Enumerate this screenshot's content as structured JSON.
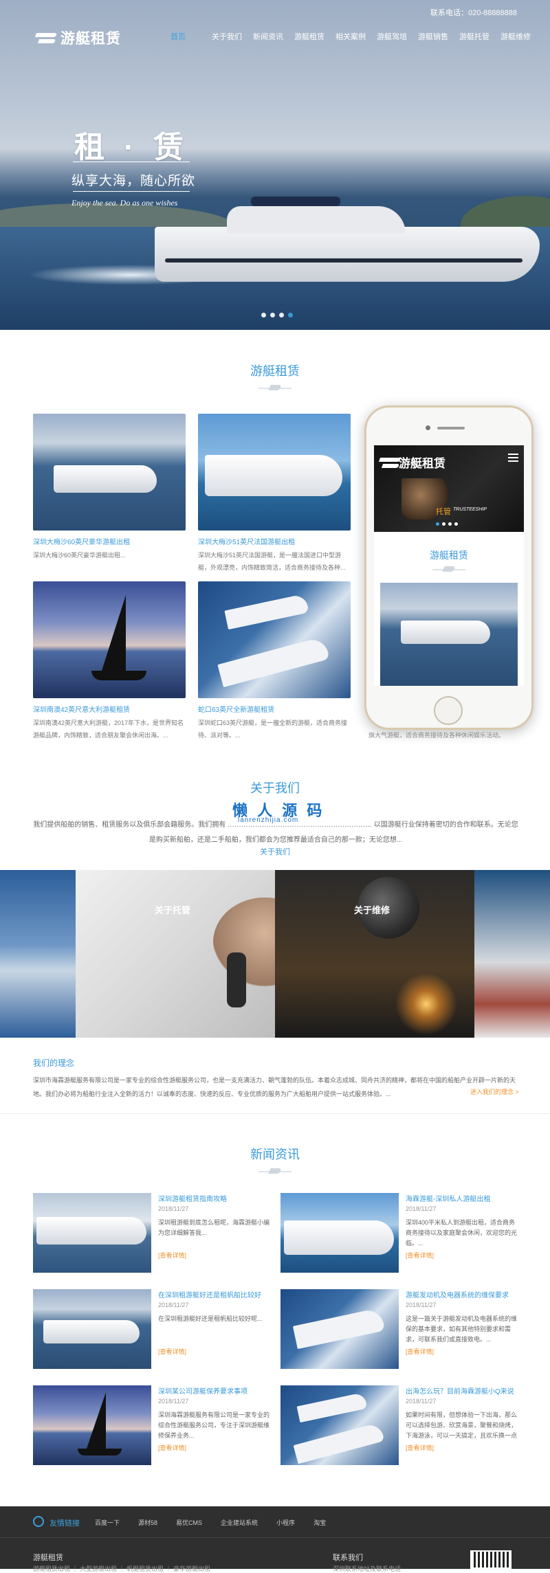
{
  "header": {
    "phone": "联系电话：020-88888888",
    "logo": "游艇租赁",
    "nav": [
      "首页",
      "关于我们",
      "新闻资讯",
      "游艇租赁",
      "相关案例",
      "游艇驾培",
      "游艇销售",
      "游艇托管",
      "游艇维修"
    ]
  },
  "hero": {
    "title": "租 · 赁",
    "subtitle": "纵享大海，随心所欲",
    "english": "Enjoy the sea.  Do as one wishes"
  },
  "rental": {
    "title": "游艇租赁",
    "cards": [
      {
        "title": "深圳大梅沙60英尺豪华游艇出租",
        "desc": "深圳大梅沙60英尺豪华游艇出租..."
      },
      {
        "title": "深圳大梅沙51英尺法国游艇出租",
        "desc": "深圳大梅沙51英尺法国游艇，是一艘法国进口中型游艇，外观漂亮，内饰精致简洁，适合商务接待及各种..."
      },
      {
        "title": "深圳南澳42英尺意大利游艇租赁",
        "desc": "深圳南澳42英尺意大利游艇，2017年下水，是世界知名游艇品牌，内饰精致，适合朋友聚会休闲出海。..."
      },
      {
        "title": "蛇口63英尺全新游艇租赁",
        "desc": "深圳蛇口63英尺游艇，是一艘全新的游艇，适合商务接待、派对等。..."
      }
    ],
    "phone": {
      "logo": "游艇租赁",
      "tag": "托管",
      "tag_en": "TRUSTEESHIP",
      "title": "游艇租赁",
      "overflow": "旗大气游艇，适合商务接待及各种休闲娱乐活动。"
    }
  },
  "about": {
    "title": "关于我们",
    "watermark": "懒 人 源 码",
    "watermark_en": "lanrenzhijia.com",
    "text": "我们提供船舶的销售、租赁服务以及俱乐部会籍服务。我们拥有 ……………………………………………………… 以国游艇行业保持着密切的合作和联系。无论您是购买新船舶，还是二手船舶，我们都会为您推荐最适合自己的那一款；无论您想...",
    "link": "关于我们",
    "band_labels": [
      "关于托管",
      "关于维修"
    ],
    "idea_title": "我们的理念",
    "idea_text": "深圳市海霖游艇服务有限公司是一家专业的综合性游艇服务公司，也是一支充满活力、朝气蓬勃的队伍。本着众志成城、同舟共济的精神，都将在中国的船舶产业开辟一片新的天地。我们办必将为船舶行业注入全新的活力！以诚奉的态度、快速的反应、专业优质的服务为广大船舶用户提供一站式服务体验。...",
    "idea_link": "进入我们的理念 >"
  },
  "news": {
    "title": "新闻资讯",
    "more": "[查看详情]",
    "items": [
      {
        "title": "深圳游艇租赁指南攻略",
        "date": "2018/11/27",
        "excerpt": "深圳租游艇到底怎么租呢，海霖游艇小编为您详细解答我..."
      },
      {
        "title": "海霖游艇-深圳私人游艇出租",
        "date": "2018/11/27",
        "excerpt": "深圳400平米私人到游艇出租，适合商务商务接待以及家庭聚会休闲，欢迎您的光临。..."
      },
      {
        "title": "在深圳租游艇好还是租帆船比较好",
        "date": "2018/11/27",
        "excerpt": "在深圳租游艇好还是租帆船比较好呢..."
      },
      {
        "title": "游艇发动机及电器系统的维保要求",
        "date": "2018/11/27",
        "excerpt": "这是一篇关于游艇发动机及电器系统的维保的基本要求，如有其他特别要求和需求，可联系我们或直接致电。..."
      },
      {
        "title": "深圳某公司游艇保养要求事项",
        "date": "2018/11/27",
        "excerpt": "深圳海霖游艇服务有限公司是一家专业的综合性游艇服务公司，专注于深圳游艇维修保养业务..."
      },
      {
        "title": "出海怎么玩？目前海霖游艇小Q来说",
        "date": "2018/11/27",
        "excerpt": "如果时间有限，但想体验一下出海，那么可以选择包游、欣赏海景，聚餐和烧烤，下海游泳，可以一天搞定，且欢乐换一点"
      }
    ]
  },
  "footer": {
    "links_label": "友情链接",
    "links": [
      "百度一下",
      "源材58",
      "易优CMS",
      "企业建站系统",
      "小程序",
      "淘宝"
    ],
    "about": "游艇租赁",
    "contact": "联系我们",
    "sub1": "游艇租赁出租 ｜ 大型游艇出租 ｜ 帆艇租赁出租 ｜ 豪华游艇出租",
    "sub2": "深圳联系地址及联系电话"
  }
}
